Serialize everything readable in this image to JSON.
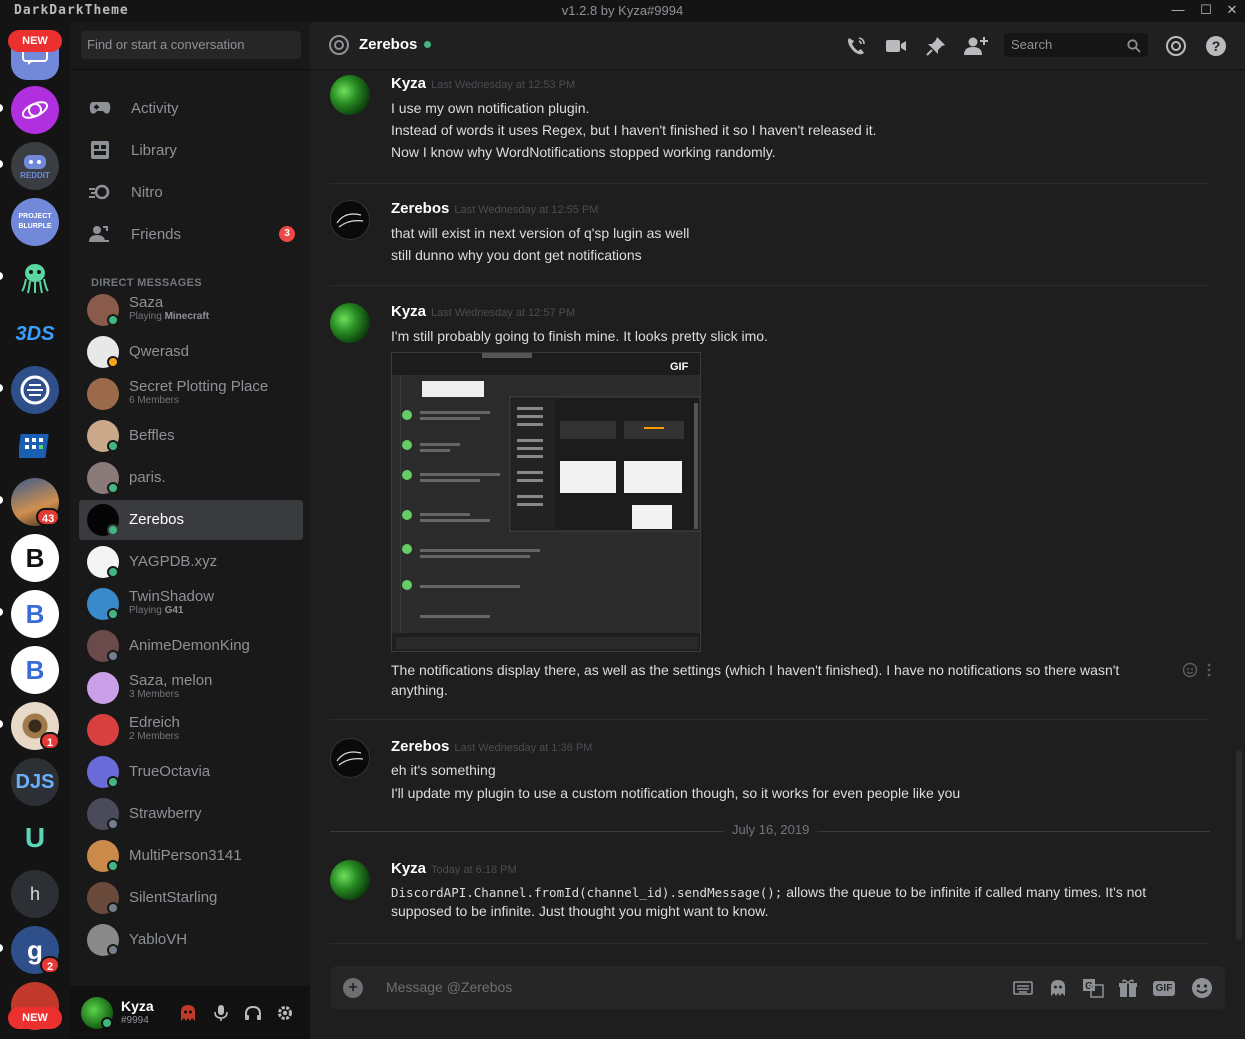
{
  "titlebar": {
    "brand": "DarkDarkTheme",
    "version": "v1.2.8 by Kyza#9994",
    "minimize": "—",
    "maximize": "☐",
    "close": "✕"
  },
  "servers": {
    "new_top": "NEW",
    "new_bottom": "NEW",
    "reddit_label": "REDDIT",
    "blurple_line1": "PROJECT",
    "blurple_line2": "BLURPLE",
    "b3ds_label": "3DS",
    "djs_label": "DJS",
    "h_label": "h",
    "g_label": "g",
    "badge_43": "43",
    "badge_1": "1",
    "badge_2": "2"
  },
  "channels": {
    "search_placeholder": "Find or start a conversation",
    "nav": [
      {
        "label": "Activity",
        "icon": "gamepad-icon"
      },
      {
        "label": "Library",
        "icon": "library-icon"
      },
      {
        "label": "Nitro",
        "icon": "nitro-icon"
      },
      {
        "label": "Friends",
        "icon": "friends-icon",
        "badge": "3"
      }
    ],
    "dm_header": "DIRECT MESSAGES",
    "dms": [
      {
        "name": "Saza",
        "sub_prefix": "Playing ",
        "sub_bold": "Minecraft",
        "status": "online",
        "color": "#8a5a4a"
      },
      {
        "name": "Qwerasd",
        "status": "idle",
        "color": "#e8e8e8"
      },
      {
        "name": "Secret Plotting Place",
        "sub": "6 Members",
        "color": "#9a6a4a"
      },
      {
        "name": "Beffles",
        "status": "online",
        "color": "#c9a98a"
      },
      {
        "name": "paris.",
        "status": "online",
        "color": "#8a7a7a"
      },
      {
        "name": "Zerebos",
        "status": "online",
        "color": "#050505"
      },
      {
        "name": "YAGPDB.xyz",
        "status": "online",
        "color": "#f4f4f4"
      },
      {
        "name": "TwinShadow",
        "sub_prefix": "Playing ",
        "sub_bold": "G41",
        "status": "online",
        "color": "#3a8ac9"
      },
      {
        "name": "AnimeDemonKing",
        "status": "offline",
        "color": "#6a4a4a"
      },
      {
        "name": "Saza, melon",
        "sub": "3 Members",
        "color": "#c9a0e8"
      },
      {
        "name": "Edreich",
        "sub": "2 Members",
        "color": "#d84040"
      },
      {
        "name": "TrueOctavia",
        "status": "online",
        "color": "#6a6ad8"
      },
      {
        "name": "Strawberry",
        "status": "offline",
        "color": "#4a4a5a"
      },
      {
        "name": "MultiPerson3141",
        "status": "online",
        "color": "#c98a4a"
      },
      {
        "name": "SilentStarling",
        "status": "offline",
        "color": "#6a4a3a"
      },
      {
        "name": "YabloVH",
        "status": "offline",
        "color": "#8a8a8a"
      }
    ]
  },
  "user": {
    "name": "Kyza",
    "tag": "#9994"
  },
  "header": {
    "title": "Zerebos",
    "search_placeholder": "Search"
  },
  "messages": [
    {
      "author": "Kyza",
      "timestamp": "Last Wednesday at 12:53 PM",
      "lines": [
        "I use my own notification plugin.",
        "Instead of words it uses Regex, but I haven't finished it so I haven't released it.",
        "Now I know why WordNotifications stopped working randomly."
      ]
    },
    {
      "author": "Zerebos",
      "timestamp": "Last Wednesday at 12:55 PM",
      "lines": [
        "that will exist in next version of q'sp lugin as well",
        "still dunno why you dont get notifications"
      ]
    },
    {
      "author": "Kyza",
      "timestamp": "Last Wednesday at 12:57 PM",
      "lines": [
        "I'm still probably going to finish mine. It looks pretty slick imo.",
        "The notifications display there, as well as the settings (which I haven't finished). I have no notifications so there wasn't",
        "anything."
      ],
      "gif_label": "GIF"
    },
    {
      "author": "Zerebos",
      "timestamp": "Last Wednesday at 1:36 PM",
      "lines": [
        "eh it's something",
        "I'll update my plugin to use a custom notification though, so it works for even people like you"
      ]
    },
    {
      "author": "Kyza",
      "timestamp": "Today at 6:18 PM",
      "code": "DiscordAPI.Channel.fromId(channel_id).sendMessage();",
      "lines": [
        " allows the queue to be infinite if called many times. It's not",
        "supposed to be infinite. Just thought you might want to know."
      ]
    }
  ],
  "date_divider": "July 16, 2019",
  "composer": {
    "placeholder": "Message @Zerebos",
    "gif": "GIF"
  }
}
